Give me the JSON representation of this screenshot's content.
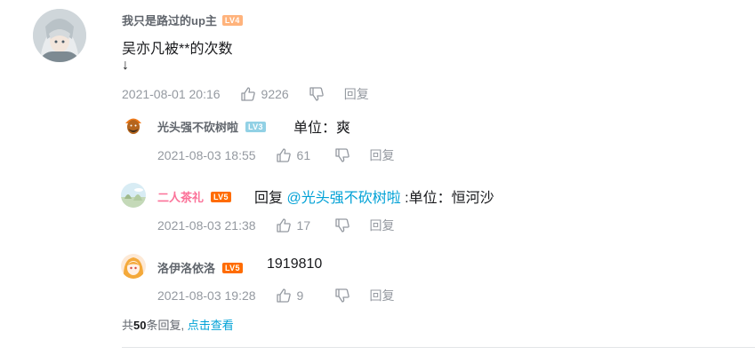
{
  "main_comment": {
    "username": "我只是路过的up主",
    "level": "LV4",
    "level_color": "#ffb37c",
    "text_line1": "吴亦凡被**的次数",
    "text_line2": "↓",
    "time": "2021-08-01 20:16",
    "likes": "9226",
    "reply_label": "回复"
  },
  "replies": [
    {
      "username": "光头强不砍树啦",
      "level": "LV3",
      "level_color": "#92d1e5",
      "text": "单位：爽",
      "time": "2021-08-03 18:55",
      "likes": "61",
      "reply_label": "回复"
    },
    {
      "username": "二人茶礼",
      "level": "LV5",
      "level_color": "#ff6c00",
      "reply_prefix": "回复 ",
      "mention": "@光头强不砍树啦",
      "text": " :单位：恒河沙",
      "time": "2021-08-03 21:38",
      "likes": "17",
      "reply_label": "回复"
    },
    {
      "username": "洛伊洛依洛",
      "level": "LV5",
      "level_color": "#ff6c00",
      "text": "1919810",
      "time": "2021-08-03 19:28",
      "likes": "9",
      "reply_label": "回复"
    }
  ],
  "footer": {
    "prefix": "共",
    "count": "50",
    "suffix": "条回复,",
    "view_all": "点击查看"
  },
  "icons": {
    "like": "thumbs-up-icon",
    "dislike": "thumbs-down-icon"
  }
}
